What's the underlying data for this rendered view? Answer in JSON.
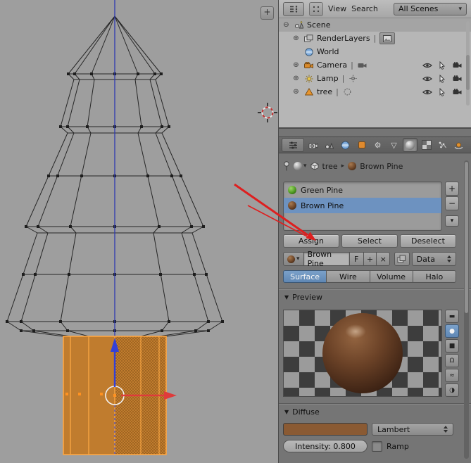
{
  "icons": {
    "expander_open": "⊖",
    "expander_closed": "⊕",
    "dropdown_arrow": "▾",
    "breadcrumb_arrow": "▸",
    "pipe": "|",
    "panel_open_arrow": "▼",
    "add": "+",
    "remove": "−",
    "close": "×",
    "gear": "⚙",
    "mesh_triangle": "▽",
    "preview_types": [
      "▬",
      "●",
      "■",
      "Ω",
      "≈",
      "◑"
    ]
  },
  "viewport": {
    "expand_button": "+",
    "selected_object_color": "#e78a2e",
    "axis_z_color": "#2e3ab0",
    "manipulator_x_color": "#df3b3b",
    "manipulator_z_color": "#3340d8"
  },
  "outliner": {
    "header": {
      "view": "View",
      "search": "Search",
      "scene_filter": "All Scenes"
    },
    "rows": [
      {
        "label": "Scene",
        "icon": "scene-icon"
      },
      {
        "label": "RenderLayers",
        "icon": "renderlayers-icon"
      },
      {
        "label": "World",
        "icon": "world-icon"
      },
      {
        "label": "Camera",
        "icon": "camera-icon"
      },
      {
        "label": "Lamp",
        "icon": "lamp-icon"
      },
      {
        "label": "tree",
        "icon": "mesh-icon"
      }
    ]
  },
  "properties": {
    "breadcrumb": {
      "object": "tree",
      "material": "Brown Pine"
    },
    "material_slots": {
      "items": [
        {
          "name": "Green Pine",
          "color": "#3f8f1f"
        },
        {
          "name": "Brown Pine",
          "color": "#5b3a26"
        }
      ],
      "selected": "Brown Pine"
    },
    "slot_actions": {
      "assign": "Assign",
      "select": "Select",
      "deselect": "Deselect"
    },
    "datablock": {
      "name": "Brown Pine",
      "fake_user": "F",
      "link_mode": "Data"
    },
    "render_types": {
      "options": [
        "Surface",
        "Wire",
        "Volume",
        "Halo"
      ],
      "selected": "Surface"
    },
    "preview_panel": {
      "title": "Preview"
    },
    "diffuse_panel": {
      "title": "Diffuse",
      "shader": "Lambert",
      "intensity": "Intensity: 0.800",
      "ramp": "Ramp",
      "color": "#8a5a33"
    },
    "selection_color": "#6d92c0"
  },
  "annotation": {
    "color": "#de1f1f"
  }
}
